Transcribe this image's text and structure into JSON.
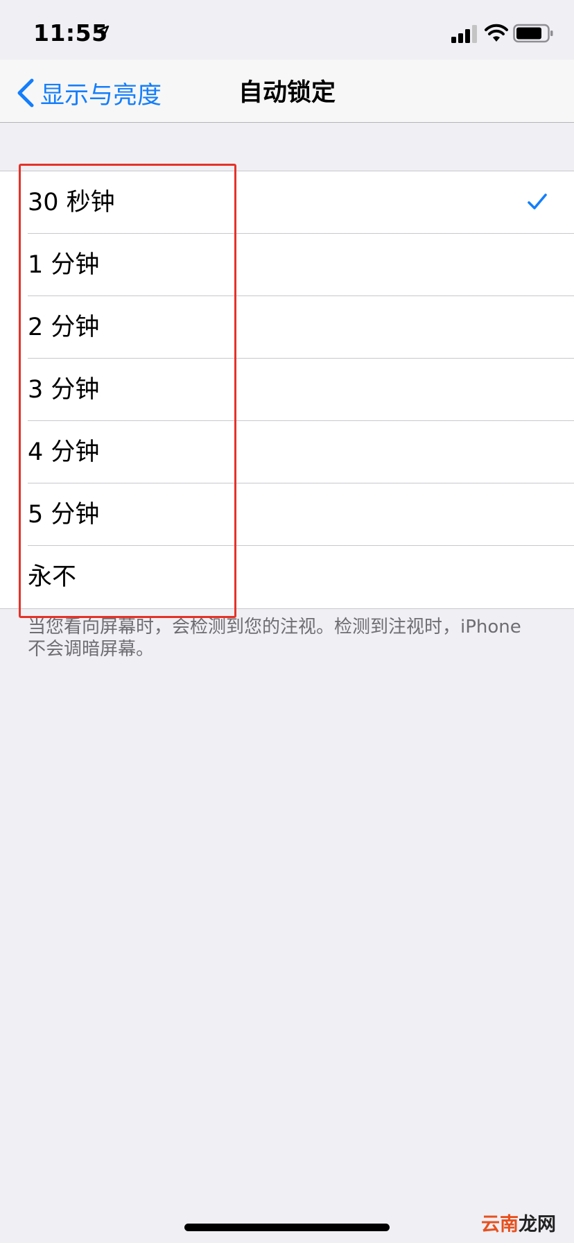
{
  "status_bar": {
    "time": "11:55"
  },
  "nav": {
    "back_label": "显示与亮度",
    "title": "自动锁定"
  },
  "options": [
    {
      "label": "30 秒钟",
      "selected": true
    },
    {
      "label": "1 分钟",
      "selected": false
    },
    {
      "label": "2 分钟",
      "selected": false
    },
    {
      "label": "3 分钟",
      "selected": false
    },
    {
      "label": "4 分钟",
      "selected": false
    },
    {
      "label": "5 分钟",
      "selected": false
    },
    {
      "label": "永不",
      "selected": false
    }
  ],
  "footer_text": "当您看向屏幕时，会检测到您的注视。检测到注视时，iPhone 不会调暗屏幕。",
  "watermark": {
    "part1": "云南",
    "part2": "龙网"
  },
  "colors": {
    "accent": "#147efb",
    "highlight": "#e63228",
    "background": "#efeff4"
  }
}
